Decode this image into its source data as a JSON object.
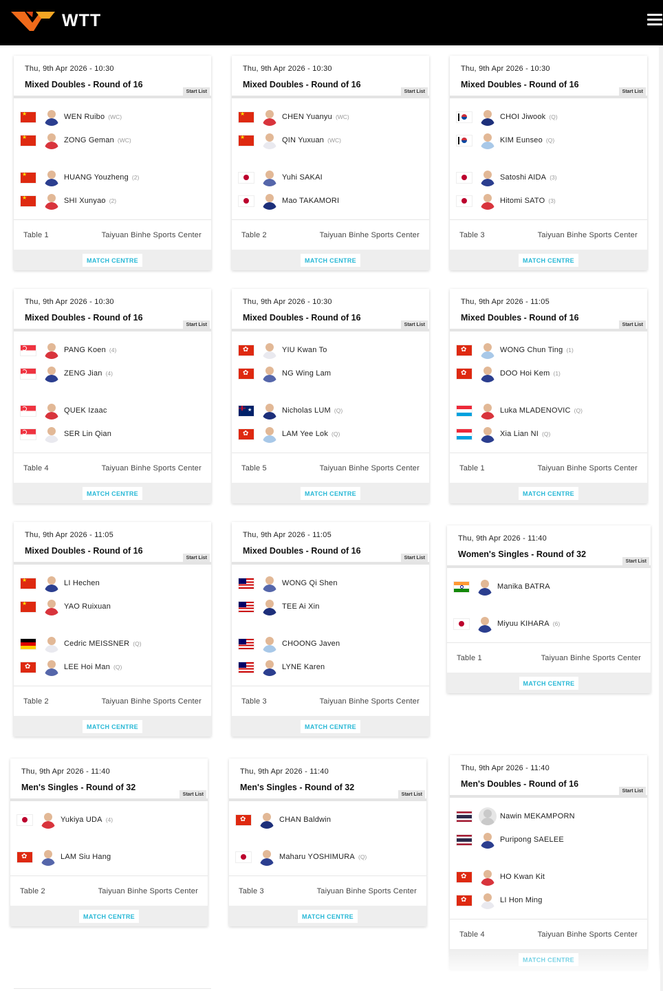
{
  "header": {
    "brand": "WTT",
    "logo_icon": "wtt-logo-icon",
    "menu_icon": "hamburger-menu-icon"
  },
  "labels": {
    "start_list": "Start List",
    "match_centre": "MATCH CENTRE"
  },
  "matches": [
    {
      "datetime": "Thu, 9th Apr 2026 - 10:30",
      "event": "Mixed Doubles - Round of 16",
      "table": "Table 1",
      "venue": "Taiyuan Binhe Sports Center",
      "teams": [
        [
          {
            "flag": "china",
            "name": "WEN Ruibo",
            "seed": "(WC)"
          },
          {
            "flag": "china",
            "name": "ZONG Geman",
            "seed": "(WC)"
          }
        ],
        [
          {
            "flag": "china",
            "name": "HUANG Youzheng",
            "seed": "(2)"
          },
          {
            "flag": "china",
            "name": "SHI Xunyao",
            "seed": "(2)"
          }
        ]
      ]
    },
    {
      "datetime": "Thu, 9th Apr 2026 - 10:30",
      "event": "Mixed Doubles - Round of 16",
      "table": "Table 2",
      "venue": "Taiyuan Binhe Sports Center",
      "teams": [
        [
          {
            "flag": "china",
            "name": "CHEN Yuanyu",
            "seed": "(WC)"
          },
          {
            "flag": "china",
            "name": "QIN Yuxuan",
            "seed": "(WC)"
          }
        ],
        [
          {
            "flag": "japan",
            "name": "Yuhi SAKAI",
            "seed": ""
          },
          {
            "flag": "japan",
            "name": "Mao TAKAMORI",
            "seed": ""
          }
        ]
      ]
    },
    {
      "datetime": "Thu, 9th Apr 2026 - 10:30",
      "event": "Mixed Doubles - Round of 16",
      "table": "Table 3",
      "venue": "Taiyuan Binhe Sports Center",
      "teams": [
        [
          {
            "flag": "korea",
            "name": "CHOI Jiwook",
            "seed": "(Q)"
          },
          {
            "flag": "korea",
            "name": "KIM Eunseo",
            "seed": "(Q)"
          }
        ],
        [
          {
            "flag": "japan",
            "name": "Satoshi AIDA",
            "seed": "(3)"
          },
          {
            "flag": "japan",
            "name": "Hitomi SATO",
            "seed": "(3)"
          }
        ]
      ]
    },
    {
      "datetime": "Thu, 9th Apr 2026 - 10:30",
      "event": "Mixed Doubles - Round of 16",
      "table": "Table 4",
      "venue": "Taiyuan Binhe Sports Center",
      "teams": [
        [
          {
            "flag": "singapore",
            "name": "PANG Koen",
            "seed": "(4)"
          },
          {
            "flag": "singapore",
            "name": "ZENG Jian",
            "seed": "(4)"
          }
        ],
        [
          {
            "flag": "singapore",
            "name": "QUEK Izaac",
            "seed": ""
          },
          {
            "flag": "singapore",
            "name": "SER Lin Qian",
            "seed": ""
          }
        ]
      ]
    },
    {
      "datetime": "Thu, 9th Apr 2026 - 10:30",
      "event": "Mixed Doubles - Round of 16",
      "table": "Table 5",
      "venue": "Taiyuan Binhe Sports Center",
      "teams": [
        [
          {
            "flag": "hong-kong",
            "name": "YIU Kwan To",
            "seed": ""
          },
          {
            "flag": "hong-kong",
            "name": "NG Wing Lam",
            "seed": ""
          }
        ],
        [
          {
            "flag": "australia",
            "name": "Nicholas LUM",
            "seed": "(Q)"
          },
          {
            "flag": "hong-kong",
            "name": "LAM Yee Lok",
            "seed": "(Q)"
          }
        ]
      ]
    },
    {
      "datetime": "Thu, 9th Apr 2026 - 11:05",
      "event": "Mixed Doubles - Round of 16",
      "table": "Table 1",
      "venue": "Taiyuan Binhe Sports Center",
      "teams": [
        [
          {
            "flag": "hong-kong",
            "name": "WONG Chun Ting",
            "seed": "(1)"
          },
          {
            "flag": "hong-kong",
            "name": "DOO Hoi Kem",
            "seed": "(1)"
          }
        ],
        [
          {
            "flag": "luxembourg",
            "name": "Luka MLADENOVIC",
            "seed": "(Q)"
          },
          {
            "flag": "luxembourg",
            "name": "Xia Lian NI",
            "seed": "(Q)"
          }
        ]
      ]
    },
    {
      "datetime": "Thu, 9th Apr 2026 - 11:05",
      "event": "Mixed Doubles - Round of 16",
      "table": "Table 2",
      "venue": "Taiyuan Binhe Sports Center",
      "teams": [
        [
          {
            "flag": "china",
            "name": "LI Hechen",
            "seed": ""
          },
          {
            "flag": "china",
            "name": "YAO Ruixuan",
            "seed": ""
          }
        ],
        [
          {
            "flag": "germany",
            "name": "Cedric MEISSNER",
            "seed": "(Q)"
          },
          {
            "flag": "hong-kong",
            "name": "LEE Hoi Man",
            "seed": "(Q)"
          }
        ]
      ]
    },
    {
      "datetime": "Thu, 9th Apr 2026 - 11:05",
      "event": "Mixed Doubles - Round of 16",
      "table": "Table 3",
      "venue": "Taiyuan Binhe Sports Center",
      "teams": [
        [
          {
            "flag": "malaysia",
            "name": "WONG Qi Shen",
            "seed": ""
          },
          {
            "flag": "malaysia",
            "name": "TEE Ai Xin",
            "seed": ""
          }
        ],
        [
          {
            "flag": "malaysia",
            "name": "CHOONG Javen",
            "seed": ""
          },
          {
            "flag": "malaysia",
            "name": "LYNE Karen",
            "seed": ""
          }
        ]
      ]
    },
    {
      "datetime": "Thu, 9th Apr 2026 - 11:40",
      "event": "Women's Singles - Round of 32",
      "table": "Table 1",
      "venue": "Taiyuan Binhe Sports Center",
      "teams": [
        [
          {
            "flag": "india",
            "name": "Manika BATRA",
            "seed": ""
          }
        ],
        [
          {
            "flag": "japan",
            "name": "Miyuu KIHARA",
            "seed": "(6)"
          }
        ]
      ]
    },
    {
      "datetime": "Thu, 9th Apr 2026 - 11:40",
      "event": "Men's Singles - Round of 32",
      "table": "Table 2",
      "venue": "Taiyuan Binhe Sports Center",
      "teams": [
        [
          {
            "flag": "japan",
            "name": "Yukiya UDA",
            "seed": "(4)"
          }
        ],
        [
          {
            "flag": "hong-kong",
            "name": "LAM Siu Hang",
            "seed": ""
          }
        ]
      ]
    },
    {
      "datetime": "Thu, 9th Apr 2026 - 11:40",
      "event": "Men's Singles - Round of 32",
      "table": "Table 3",
      "venue": "Taiyuan Binhe Sports Center",
      "teams": [
        [
          {
            "flag": "hong-kong",
            "name": "CHAN Baldwin",
            "seed": ""
          }
        ],
        [
          {
            "flag": "japan",
            "name": "Maharu YOSHIMURA",
            "seed": "(Q)"
          }
        ]
      ]
    },
    {
      "datetime": "Thu, 9th Apr 2026 - 11:40",
      "event": "Men's Doubles - Round of 16",
      "table": "Table 4",
      "venue": "Taiyuan Binhe Sports Center",
      "teams": [
        [
          {
            "flag": "thailand",
            "name": "Nawin MEKAMPORN",
            "seed": ""
          },
          {
            "flag": "thailand",
            "name": "Puripong SAELEE",
            "seed": ""
          }
        ],
        [
          {
            "flag": "hong-kong",
            "name": "HO Kwan Kit",
            "seed": ""
          },
          {
            "flag": "hong-kong",
            "name": "LI Hon Ming",
            "seed": ""
          }
        ]
      ]
    }
  ]
}
